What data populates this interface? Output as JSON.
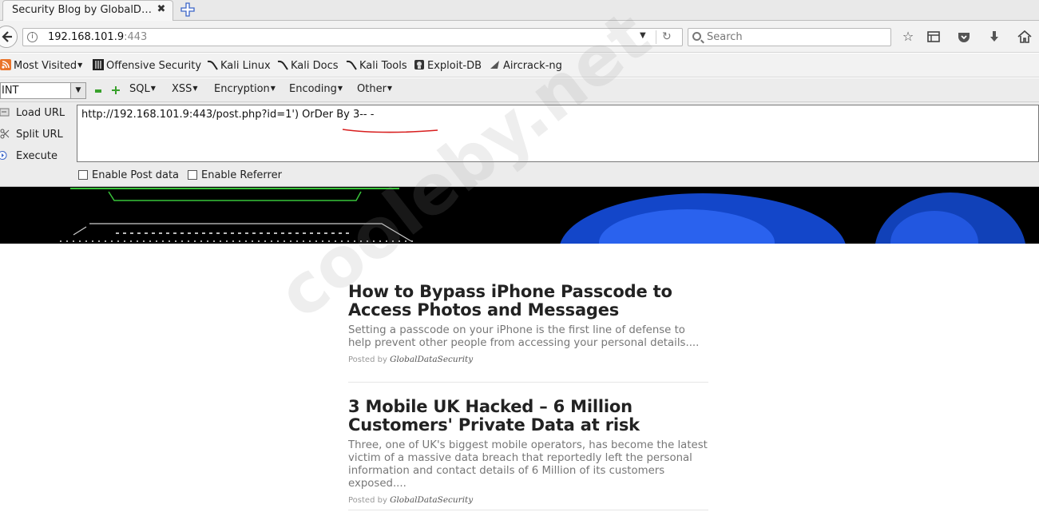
{
  "browser": {
    "tab_title": "Security Blog by GlobalD…",
    "tab_close": "✖",
    "url_host": "192.168.101.9",
    "url_port": ":443",
    "search_placeholder": "Search"
  },
  "bookmarks": [
    {
      "label": "Most Visited",
      "icon": "rss-icon"
    },
    {
      "label": "Offensive Security",
      "icon": "offsec-icon"
    },
    {
      "label": "Kali Linux",
      "icon": "kali-dragon-icon"
    },
    {
      "label": "Kali Docs",
      "icon": "kali-dragon-icon"
    },
    {
      "label": "Kali Tools",
      "icon": "kali-dragon-icon"
    },
    {
      "label": "Exploit-DB",
      "icon": "exploitdb-icon"
    },
    {
      "label": "Aircrack-ng",
      "icon": "aircrack-icon"
    }
  ],
  "hackbar": {
    "type_select": "INT",
    "menus": [
      "SQL",
      "XSS",
      "Encryption",
      "Encoding",
      "Other"
    ],
    "actions": {
      "load": "Load URL",
      "split": "Split URL",
      "execute": "Execute"
    },
    "url_text": "http://192.168.101.9:443/post.php?id=1') OrDer By 3-- -",
    "enable_post": "Enable Post data",
    "enable_referrer": "Enable Referrer"
  },
  "posts": [
    {
      "title": "How to Bypass iPhone Passcode to Access Photos and Messages",
      "excerpt": "Setting a passcode on your iPhone is the first line of defense to help prevent other people from accessing your personal details....",
      "posted_by": "Posted by",
      "author": "GlobalDataSecurity"
    },
    {
      "title": "3 Mobile UK Hacked – 6 Million Customers' Private Data at risk",
      "excerpt": "Three, one of UK's biggest mobile operators, has become the latest victim of a massive data breach that reportedly left the personal information and contact details of 6 Million of its customers exposed....",
      "posted_by": "Posted by",
      "author": "GlobalDataSecurity"
    }
  ],
  "watermark": "cooleby.net",
  "colors": {
    "underline": "#d81e1e",
    "hackbar_green": "#39a12c",
    "banner_bg": "#000000"
  }
}
